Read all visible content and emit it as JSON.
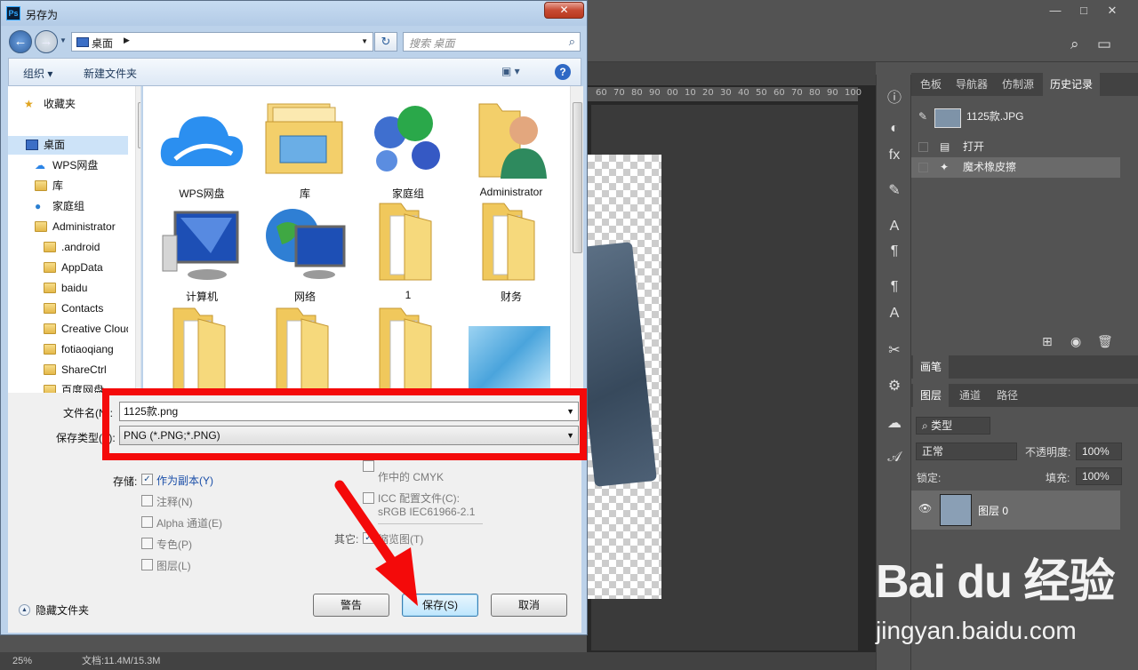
{
  "photoshop": {
    "window_buttons": [
      "—",
      "□",
      "✕"
    ],
    "panel_tabs_top": [
      "色板",
      "导航器",
      "仿制源",
      "历史记录"
    ],
    "history": {
      "snapshot_name": "1125款.JPG",
      "steps": [
        "打开",
        "魔术橡皮擦"
      ]
    },
    "brush_tab": "画笔",
    "layers_tabs": [
      "图层",
      "通道",
      "路径"
    ],
    "layer_filter": "类型",
    "blend_mode": "正常",
    "opacity_label": "不透明度:",
    "opacity_value": "100%",
    "lock_label": "锁定:",
    "fill_label": "填充:",
    "fill_value": "100%",
    "layer_name": "图层 0",
    "ruler_ticks": [
      "60",
      "70",
      "80",
      "90",
      "00",
      "10",
      "20",
      "30",
      "40",
      "50",
      "60",
      "70",
      "80",
      "90",
      "100"
    ],
    "status_zoom": "25%",
    "status_doc": "文档:11.4M/15.3M",
    "watermark_big": "Bai du 经验",
    "watermark_url": "jingyan.baidu.com"
  },
  "dialog": {
    "title": "另存为",
    "close_label": "✕",
    "address": "桌面",
    "search_placeholder": "搜索 桌面",
    "toolbar": {
      "organize": "组织 ▾",
      "new_folder": "新建文件夹"
    },
    "nav_items": [
      "收藏夹",
      "桌面",
      "WPS网盘",
      "库",
      "家庭组",
      "Administrator",
      ".android",
      "AppData",
      "baidu",
      "Contacts",
      "Creative Cloud",
      "fotiaoqiang",
      "ShareCtrl",
      "百度网盘"
    ],
    "files": [
      "WPS网盘",
      "库",
      "家庭组",
      "Administrator",
      "计算机",
      "网络",
      "1",
      "财务"
    ],
    "filename_label": "文件名(N):",
    "filename_value": "1125款.png",
    "filetype_label": "保存类型(T):",
    "filetype_value": "PNG (*.PNG;*.PNG)",
    "save_label": "存储:",
    "save_options": {
      "as_copy": "作为副本(Y)",
      "notes": "注释(N)",
      "alpha": "Alpha 通道(E)",
      "spot": "专色(P)",
      "layers": "图层(L)"
    },
    "color_options": {
      "cmyk_fragment": "作中的 CMYK",
      "icc": "ICC 配置文件(C):",
      "icc_value": "sRGB IEC61966-2.1"
    },
    "other_label": "其它:",
    "thumbnail": "缩览图(T)",
    "buttons": {
      "warning": "警告",
      "save": "保存(S)",
      "cancel": "取消"
    },
    "hide_folders": "隐藏文件夹"
  },
  "colors": {
    "highlight_red": "#f40a0a",
    "dialog_frame": "#bcd2ea",
    "photoshop_bg": "#535353"
  }
}
